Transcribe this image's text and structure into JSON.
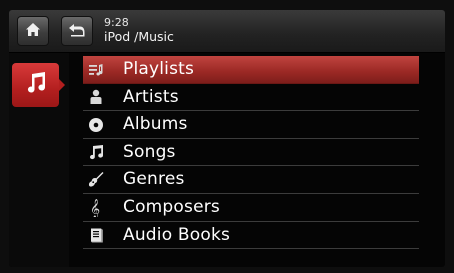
{
  "header": {
    "home_icon": "home-icon",
    "back_icon": "back-arrow-icon",
    "time": "9:28",
    "path": "iPod /Music"
  },
  "sidebar": {
    "source_icon": "music-note-icon",
    "accent": "#b31f1f"
  },
  "menu": {
    "selected_index": 0,
    "items": [
      {
        "label": "Playlists",
        "icon": "playlist-icon"
      },
      {
        "label": "Artists",
        "icon": "artist-icon"
      },
      {
        "label": "Albums",
        "icon": "album-disc-icon"
      },
      {
        "label": "Songs",
        "icon": "music-note-icon"
      },
      {
        "label": "Genres",
        "icon": "guitar-icon"
      },
      {
        "label": "Composers",
        "icon": "treble-clef-icon"
      },
      {
        "label": "Audio Books",
        "icon": "book-icon"
      }
    ]
  }
}
